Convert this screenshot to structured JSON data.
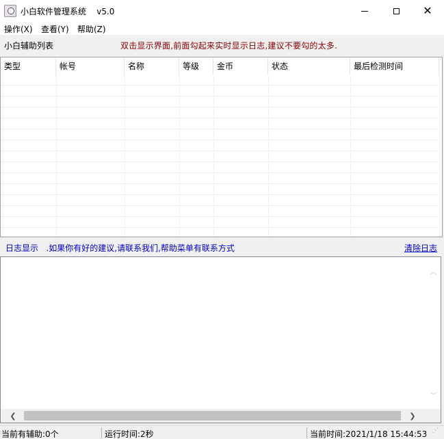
{
  "window": {
    "title": "小白软件管理系统    v5.0",
    "minimize_glyph": "",
    "maximize_glyph": "",
    "close_glyph": "✕"
  },
  "menu": {
    "items": [
      "操作(X)",
      "查看(Y)",
      "帮助(Z)"
    ]
  },
  "list_section": {
    "label": "小白辅助列表",
    "hint": "双击显示界面,前面勾起来实时显示日志,建议不要勾的太多."
  },
  "table": {
    "columns": [
      "类型",
      "帐号",
      "名称",
      "等级",
      "金币",
      "状态",
      "最后检测时间"
    ],
    "rows": []
  },
  "log_section": {
    "label": "日志显示   .如果你有好的建议,请联系我们,帮助菜单有联系方式",
    "clear_link": "清除日志",
    "content": ""
  },
  "scrollbars": {
    "up_glyph": "︿",
    "down_glyph": "﹀",
    "left_glyph": "❮",
    "right_glyph": "❯"
  },
  "status_bar": {
    "helpers": "当前有辅助:0个",
    "runtime": "运行时间:2秒",
    "current_time": "当前时间:2021/1/18 15:44:53"
  }
}
